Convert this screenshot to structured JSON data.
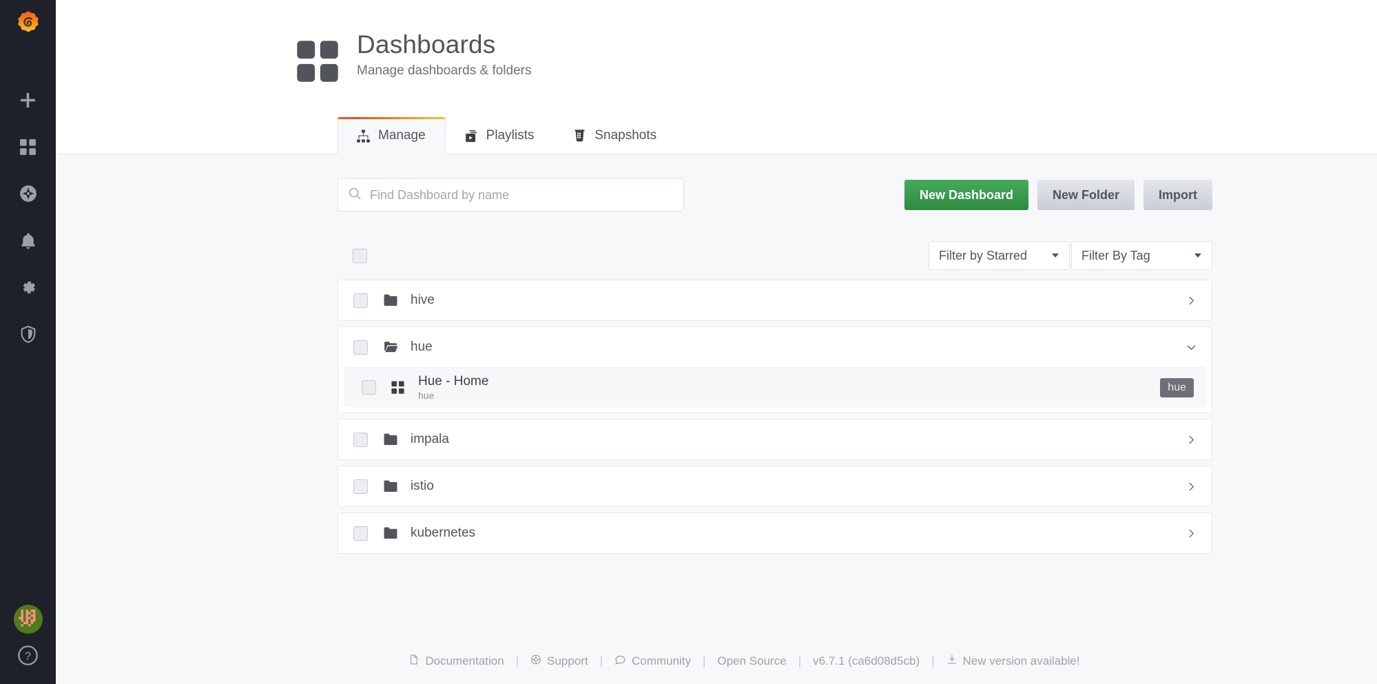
{
  "colors": {
    "sidebar_bg": "#1e2129",
    "accent_orange": "#f05a28",
    "accent_yellow": "#fbc02d",
    "primary_green": "#2f8a42",
    "text_dark": "#52545c",
    "page_bg": "#f7f8fa",
    "tag_bg": "#6e7078"
  },
  "sidebar": {
    "logo": "grafana-logo-icon",
    "items": [
      {
        "name": "create-add",
        "icon": "plus-icon"
      },
      {
        "name": "dashboards",
        "icon": "dashboards-grid-icon"
      },
      {
        "name": "explore",
        "icon": "compass-icon"
      },
      {
        "name": "alerting",
        "icon": "bell-icon"
      },
      {
        "name": "configuration",
        "icon": "gear-icon"
      },
      {
        "name": "server-admin",
        "icon": "shield-icon"
      }
    ],
    "bottom": [
      {
        "name": "user-avatar",
        "icon": "avatar-icon"
      },
      {
        "name": "help",
        "icon": "question-circle-icon"
      }
    ]
  },
  "header": {
    "icon": "dashboards-grid-icon",
    "title": "Dashboards",
    "subtitle": "Manage dashboards & folders"
  },
  "tabs": [
    {
      "label": "Manage",
      "icon": "sitemap-icon",
      "active": true
    },
    {
      "label": "Playlists",
      "icon": "playlist-icon",
      "active": false
    },
    {
      "label": "Snapshots",
      "icon": "snapshot-camera-icon",
      "active": false
    }
  ],
  "toolbar": {
    "search_placeholder": "Find Dashboard by name",
    "search_value": "",
    "search_icon": "search-icon",
    "new_dashboard_label": "New Dashboard",
    "new_folder_label": "New Folder",
    "import_label": "Import"
  },
  "filters": {
    "select_all_checked": false,
    "starred": {
      "label": "Filter by Starred",
      "value": ""
    },
    "tag": {
      "label": "Filter By Tag",
      "value": ""
    }
  },
  "list": [
    {
      "type": "folder",
      "title": "hive",
      "icon": "folder-closed-icon",
      "expanded": false,
      "chevron": "chevron-right-icon",
      "checked": false,
      "children": []
    },
    {
      "type": "folder",
      "title": "hue",
      "icon": "folder-open-icon",
      "expanded": true,
      "chevron": "chevron-down-icon",
      "checked": false,
      "children": [
        {
          "type": "dashboard",
          "title": "Hue - Home",
          "subtitle": "hue",
          "icon": "dashboard-grid-icon",
          "checked": false,
          "tags": [
            "hue"
          ]
        }
      ]
    },
    {
      "type": "folder",
      "title": "impala",
      "icon": "folder-closed-icon",
      "expanded": false,
      "chevron": "chevron-right-icon",
      "checked": false,
      "children": []
    },
    {
      "type": "folder",
      "title": "istio",
      "icon": "folder-closed-icon",
      "expanded": false,
      "chevron": "chevron-right-icon",
      "checked": false,
      "children": []
    },
    {
      "type": "folder",
      "title": "kubernetes",
      "icon": "folder-closed-icon",
      "expanded": false,
      "chevron": "chevron-right-icon",
      "checked": false,
      "children": []
    }
  ],
  "footer": {
    "documentation": "Documentation",
    "support": "Support",
    "community": "Community",
    "open_source": "Open Source",
    "version": "v6.7.1 (ca6d08d5cb)",
    "new_version": "New version available!",
    "separator": "|"
  }
}
